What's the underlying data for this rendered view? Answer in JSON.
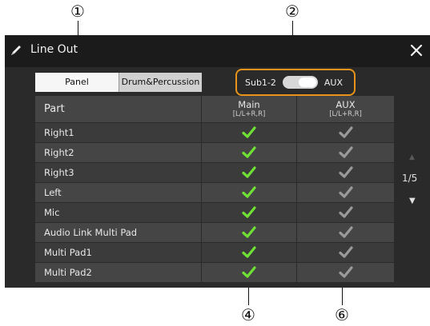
{
  "callouts": {
    "c1": "①",
    "c2": "②",
    "c4": "④",
    "c6": "⑥"
  },
  "window": {
    "title": "Line Out",
    "icon": "pen-icon",
    "close_icon": "close-icon"
  },
  "tabs": {
    "panel": "Panel",
    "drum": "Drum&Percussion",
    "selected": "Panel"
  },
  "toggle": {
    "left_label": "Sub1-2",
    "right_label": "AUX",
    "state": "AUX"
  },
  "table": {
    "header": {
      "part": "Part",
      "main": "Main",
      "main_sub": "[L/L+R,R]",
      "aux": "AUX",
      "aux_sub": "[L/L+R,R]"
    },
    "rows": [
      {
        "part": "Right1",
        "main": "checked",
        "aux": "checked"
      },
      {
        "part": "Right2",
        "main": "checked",
        "aux": "checked"
      },
      {
        "part": "Right3",
        "main": "checked",
        "aux": "checked"
      },
      {
        "part": "Left",
        "main": "checked",
        "aux": "checked"
      },
      {
        "part": "Mic",
        "main": "checked",
        "aux": "checked"
      },
      {
        "part": "Audio Link Multi Pad",
        "main": "checked",
        "aux": "checked"
      },
      {
        "part": "Multi Pad1",
        "main": "checked",
        "aux": "checked"
      },
      {
        "part": "Multi Pad2",
        "main": "checked",
        "aux": "checked"
      }
    ]
  },
  "pager": {
    "page": "1/5"
  },
  "colors": {
    "main_check": "#6fe034",
    "aux_check": "#9a9a9a",
    "highlight": "#e8941a"
  }
}
